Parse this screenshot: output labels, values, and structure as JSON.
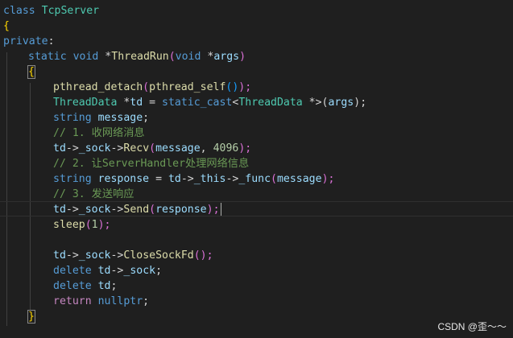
{
  "code_lines": [
    [
      "class ",
      "TcpServer"
    ],
    [
      "{"
    ],
    [
      "private",
      ":"
    ],
    [
      "static",
      " ",
      "void",
      " *",
      "ThreadRun",
      "(",
      "void",
      " *",
      "args",
      ")"
    ],
    [
      "{"
    ],
    [
      "pthread_detach",
      "(",
      "pthread_self",
      "()",
      ");"
    ],
    [
      "ThreadData",
      " *",
      "td",
      " = ",
      "static_cast",
      "<",
      "ThreadData",
      " *>(",
      "args",
      ");"
    ],
    [
      "string",
      " ",
      "message",
      ";"
    ],
    [
      "// 1. 收网络消息"
    ],
    [
      "td",
      "->",
      "_sock",
      "->",
      "Recv",
      "(",
      "message",
      ", ",
      "4096",
      ");"
    ],
    [
      "// 2. 让ServerHandler处理网络信息"
    ],
    [
      "string",
      " ",
      "response",
      " = ",
      "td",
      "->",
      "_this",
      "->",
      "_func",
      "(",
      "message",
      ");"
    ],
    [
      "// 3. 发送响应"
    ],
    [
      "td",
      "->",
      "_sock",
      "->",
      "Send",
      "(",
      "response",
      ");"
    ],
    [
      "sleep",
      "(",
      "1",
      ");"
    ],
    [
      ""
    ],
    [
      "td",
      "->",
      "_sock",
      "->",
      "CloseSockFd",
      "();"
    ],
    [
      "delete",
      " ",
      "td",
      "->",
      "_sock",
      ";"
    ],
    [
      "delete",
      " ",
      "td",
      ";"
    ],
    [
      "return",
      " ",
      "nullptr",
      ";"
    ],
    [
      "}"
    ]
  ],
  "watermark": "CSDN @歪～～"
}
